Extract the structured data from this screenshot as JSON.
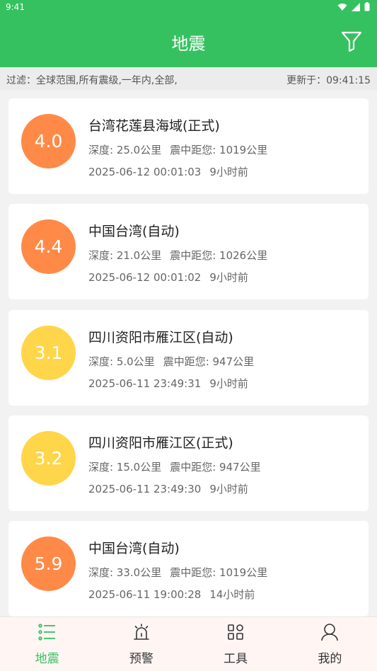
{
  "status": {
    "time": "9:41"
  },
  "header": {
    "title": "地震"
  },
  "filter": {
    "text": "过滤：全球范围,所有震级,一年内,全部,",
    "updated": "更新于：09:41:15"
  },
  "colors": {
    "primary": "#36c160",
    "orange": "#ff8a47",
    "yellow": "#ffd54a"
  },
  "quakes": [
    {
      "mag": "4.0",
      "color": "#ff8a47",
      "place": "台湾花莲县海域(正式)",
      "depth": "深度: 25.0公里",
      "distance": "震中距您: 1019公里",
      "datetime": "2025-06-12 00:01:03",
      "ago": "9小时前"
    },
    {
      "mag": "4.4",
      "color": "#ff8a47",
      "place": "中国台湾(自动)",
      "depth": "深度: 21.0公里",
      "distance": "震中距您: 1026公里",
      "datetime": "2025-06-12 00:01:02",
      "ago": "9小时前"
    },
    {
      "mag": "3.1",
      "color": "#ffd54a",
      "place": "四川资阳市雁江区(自动)",
      "depth": "深度: 5.0公里",
      "distance": "震中距您: 947公里",
      "datetime": "2025-06-11 23:49:31",
      "ago": "9小时前"
    },
    {
      "mag": "3.2",
      "color": "#ffd54a",
      "place": "四川资阳市雁江区(正式)",
      "depth": "深度: 15.0公里",
      "distance": "震中距您: 947公里",
      "datetime": "2025-06-11 23:49:30",
      "ago": "9小时前"
    },
    {
      "mag": "5.9",
      "color": "#ff8a47",
      "place": "中国台湾(自动)",
      "depth": "深度: 33.0公里",
      "distance": "震中距您: 1019公里",
      "datetime": "2025-06-11 19:00:28",
      "ago": "14小时前"
    }
  ],
  "nav": [
    {
      "label": "地震",
      "icon": "list-icon"
    },
    {
      "label": "预警",
      "icon": "alarm-icon"
    },
    {
      "label": "工具",
      "icon": "tools-grid-icon"
    },
    {
      "label": "我的",
      "icon": "user-icon"
    }
  ]
}
